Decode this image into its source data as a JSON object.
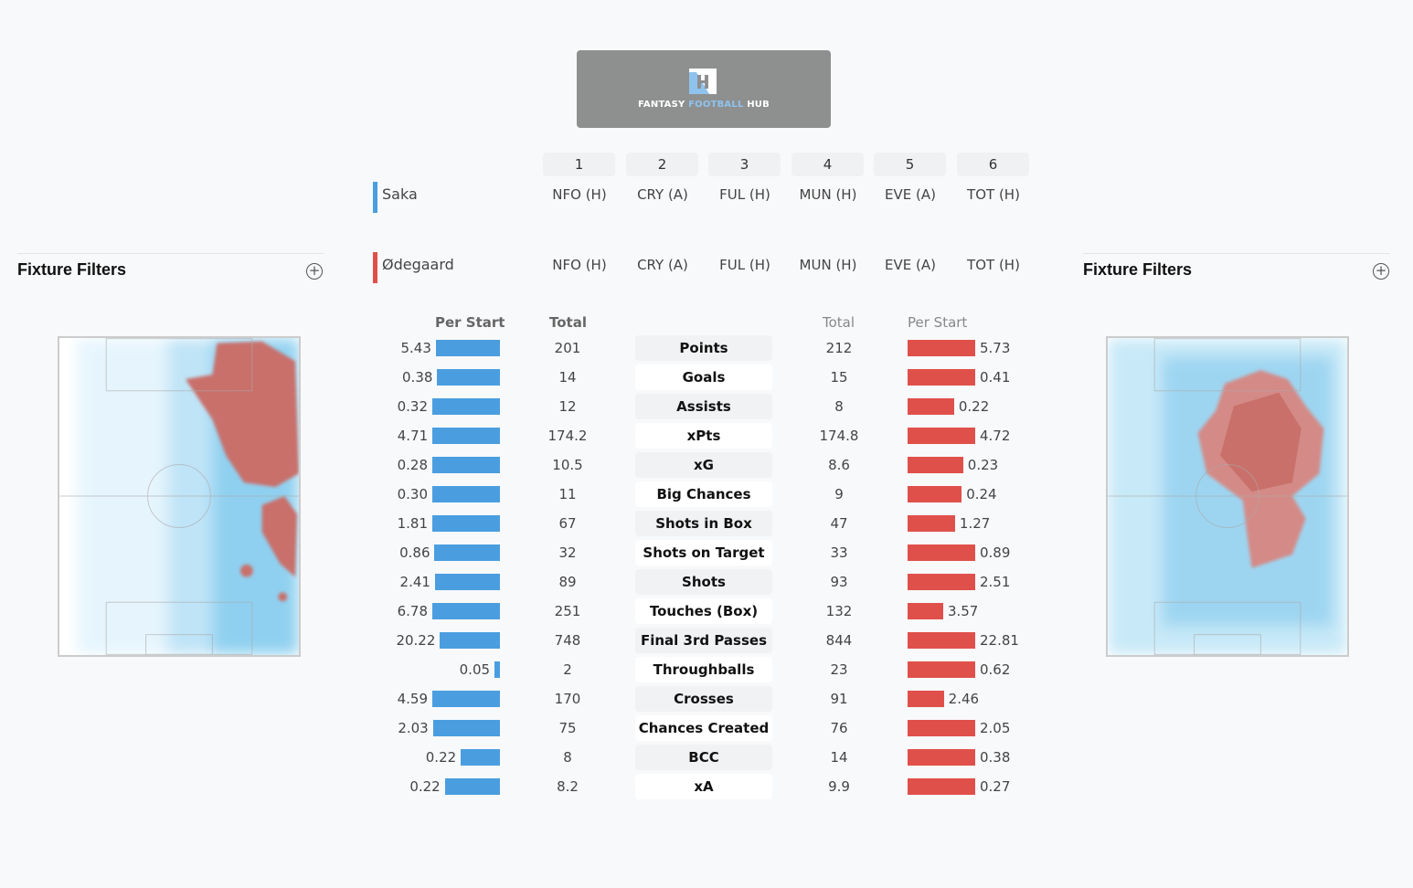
{
  "logo": {
    "text_a": "FANTASY ",
    "text_b": "FOOTBALL",
    "text_c": " HUB"
  },
  "gameweeks": [
    "1",
    "2",
    "3",
    "4",
    "5",
    "6"
  ],
  "players": [
    {
      "name": "Saka",
      "color": "#4a9ee0",
      "fixtures": [
        "NFO (H)",
        "CRY (A)",
        "FUL (H)",
        "MUN (H)",
        "EVE (A)",
        "TOT (H)"
      ]
    },
    {
      "name": "Ødegaard",
      "color": "#e0504a",
      "fixtures": [
        "NFO (H)",
        "CRY (A)",
        "FUL (H)",
        "MUN (H)",
        "EVE (A)",
        "TOT (H)"
      ]
    }
  ],
  "filters": {
    "left_title": "Fixture Filters",
    "right_title": "Fixture Filters",
    "icon": "plus-circle-icon"
  },
  "headers": {
    "left_per_start": "Per Start",
    "left_total": "Total",
    "right_total": "Total",
    "right_per_start": "Per Start"
  },
  "colors": {
    "left_bar": "#4a9ee0",
    "right_bar": "#e0504a"
  },
  "stats": [
    {
      "label": "Points",
      "l_per": "5.43",
      "l_tot": "201",
      "r_tot": "212",
      "r_per": "5.73"
    },
    {
      "label": "Goals",
      "l_per": "0.38",
      "l_tot": "14",
      "r_tot": "15",
      "r_per": "0.41"
    },
    {
      "label": "Assists",
      "l_per": "0.32",
      "l_tot": "12",
      "r_tot": "8",
      "r_per": "0.22"
    },
    {
      "label": "xPts",
      "l_per": "4.71",
      "l_tot": "174.2",
      "r_tot": "174.8",
      "r_per": "4.72"
    },
    {
      "label": "xG",
      "l_per": "0.28",
      "l_tot": "10.5",
      "r_tot": "8.6",
      "r_per": "0.23"
    },
    {
      "label": "Big Chances",
      "l_per": "0.30",
      "l_tot": "11",
      "r_tot": "9",
      "r_per": "0.24"
    },
    {
      "label": "Shots in Box",
      "l_per": "1.81",
      "l_tot": "67",
      "r_tot": "47",
      "r_per": "1.27"
    },
    {
      "label": "Shots on Target",
      "l_per": "0.86",
      "l_tot": "32",
      "r_tot": "33",
      "r_per": "0.89"
    },
    {
      "label": "Shots",
      "l_per": "2.41",
      "l_tot": "89",
      "r_tot": "93",
      "r_per": "2.51"
    },
    {
      "label": "Touches (Box)",
      "l_per": "6.78",
      "l_tot": "251",
      "r_tot": "132",
      "r_per": "3.57"
    },
    {
      "label": "Final 3rd Passes",
      "l_per": "20.22",
      "l_tot": "748",
      "r_tot": "844",
      "r_per": "22.81"
    },
    {
      "label": "Throughballs",
      "l_per": "0.05",
      "l_tot": "2",
      "r_tot": "23",
      "r_per": "0.62"
    },
    {
      "label": "Crosses",
      "l_per": "4.59",
      "l_tot": "170",
      "r_tot": "91",
      "r_per": "2.46"
    },
    {
      "label": "Chances Created",
      "l_per": "2.03",
      "l_tot": "75",
      "r_tot": "76",
      "r_per": "2.05"
    },
    {
      "label": "BCC",
      "l_per": "0.22",
      "l_tot": "8",
      "r_tot": "14",
      "r_per": "0.38"
    },
    {
      "label": "xA",
      "l_per": "0.22",
      "l_tot": "8.2",
      "r_tot": "9.9",
      "r_per": "0.27"
    }
  ]
}
